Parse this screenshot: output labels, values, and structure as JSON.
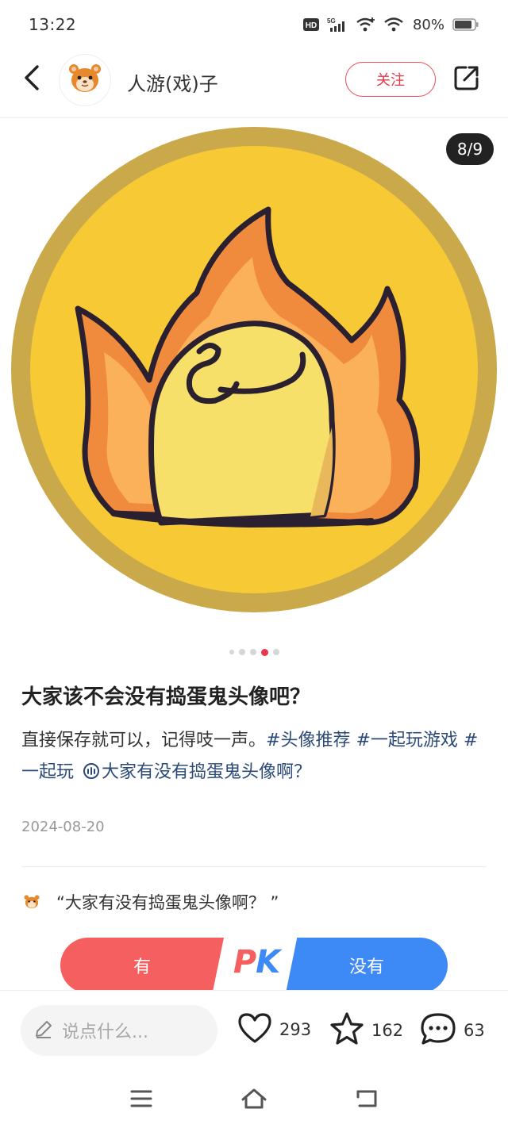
{
  "status_bar": {
    "time": "13:22",
    "hd_label": "HD",
    "network": "5G",
    "battery": "80%"
  },
  "header": {
    "author": "人游(戏)子",
    "follow_label": "关注"
  },
  "image": {
    "counter": "8/9",
    "total_pages": 9,
    "current_page": 8
  },
  "post": {
    "title": "大家该不会没有捣蛋鬼头像吧？",
    "body_text": "直接保存就可以，记得吱一声。",
    "tags": [
      "#头像推荐",
      "#一起玩游戏",
      "#一起玩"
    ],
    "topic": "大家有没有捣蛋鬼头像啊？",
    "date": "2024-08-20"
  },
  "vote": {
    "question": "“大家有没有捣蛋鬼头像啊？ ”",
    "option_yes": "有",
    "option_no": "没有",
    "pk_p": "P",
    "pk_k": "K"
  },
  "bottom_bar": {
    "comment_placeholder": "说点什么...",
    "likes": "293",
    "favorites": "162",
    "comments": "63"
  },
  "colors": {
    "accent_red": "#e33a4a",
    "vote_red": "#f65f5f",
    "vote_blue": "#3d8af7",
    "tag_blue": "#2c4a78",
    "coin_outer": "#c9a94a",
    "coin_inner": "#f7c935"
  },
  "icons": {
    "back": "chevron-left-icon",
    "share": "external-share-icon",
    "like": "heart-icon",
    "favorite": "star-icon",
    "comment": "speech-bubble-icon",
    "edit": "pencil-icon",
    "nav_menu": "menu-icon",
    "nav_home": "home-icon",
    "nav_back": "return-icon"
  }
}
